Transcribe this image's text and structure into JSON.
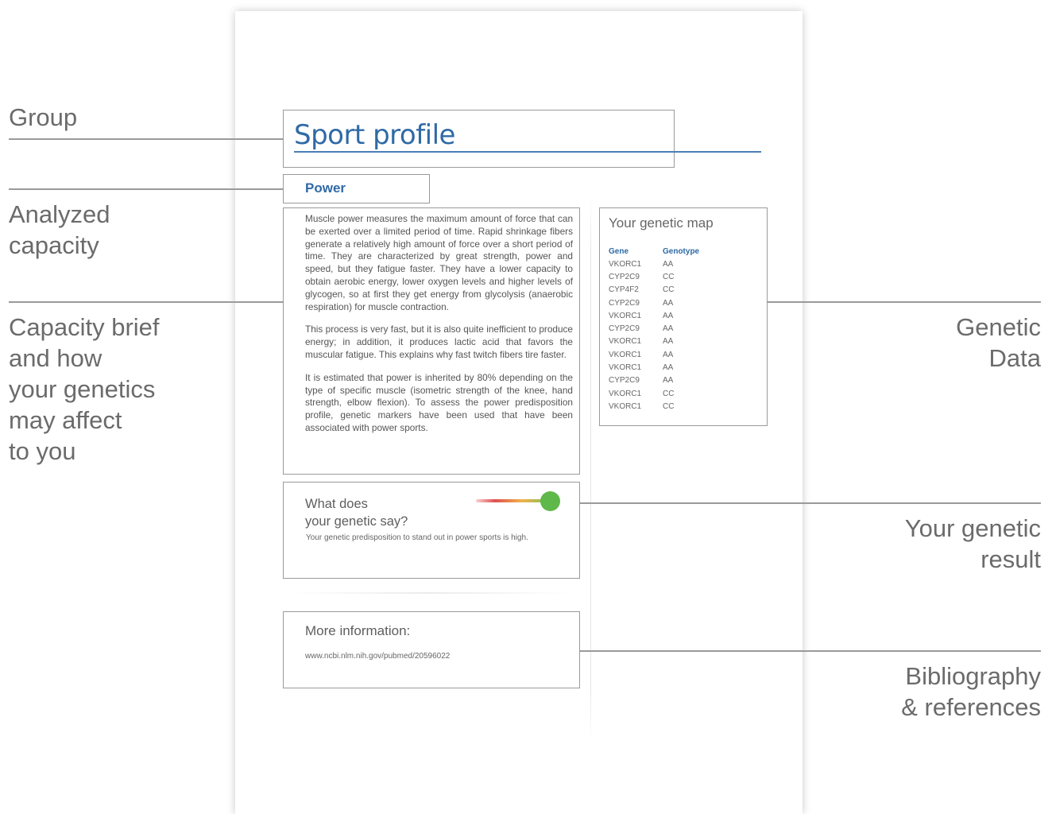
{
  "annotations": {
    "group": "Group",
    "analyzed_capacity": [
      "Analyzed",
      "capacity"
    ],
    "capacity_brief": [
      "Capacity brief",
      "and how",
      "your genetics",
      "may affect",
      "to you"
    ],
    "genetic_data": [
      "Genetic",
      "Data"
    ],
    "genetic_result": [
      "Your genetic",
      "result"
    ],
    "bibliography": [
      "Bibliography",
      "& references"
    ]
  },
  "document": {
    "group_title": "Sport profile",
    "capacity_title": "Power",
    "brief_paragraphs": [
      "Muscle power measures the maximum amount of force that can be exerted over a limited period of time. Rapid shrinkage fibers generate a relatively high amount of force over a short period of time. They are characterized by great strength, power and speed, but they fatigue faster. They have a lower capacity to obtain aerobic energy, lower oxygen levels and higher levels of glycogen, so at first they get energy from glycolysis (anaerobic respiration) for muscle contraction.",
      "This process is very fast, but it is also quite inefficient to produce energy; in addition, it produces lactic acid that favors the muscular fatigue. This explains why fast twitch fibers tire faster.",
      "It is estimated that power is inherited by 80% depending on the type of specific muscle (isometric strength of the knee, hand strength, elbow flexion). To assess the power predisposition profile, genetic markers have been used that have been associated with power sports."
    ],
    "genetic_map": {
      "title": "Your genetic map",
      "headers": [
        "Gene",
        "Genotype"
      ],
      "rows": [
        [
          "VKORC1",
          "AA"
        ],
        [
          "CYP2C9",
          "CC"
        ],
        [
          "CYP4F2",
          "CC"
        ],
        [
          "CYP2C9",
          "AA"
        ],
        [
          "VKORC1",
          "AA"
        ],
        [
          "CYP2C9",
          "AA"
        ],
        [
          "VKORC1",
          "AA"
        ],
        [
          "VKORC1",
          "AA"
        ],
        [
          "VKORC1",
          "AA"
        ],
        [
          "CYP2C9",
          "AA"
        ],
        [
          "VKORC1",
          "CC"
        ],
        [
          "VKORC1",
          "CC"
        ]
      ]
    },
    "result": {
      "title_line1": "What does",
      "title_line2": "your genetic say?",
      "text": "Your genetic predisposition to stand out in power sports is high.",
      "level": 1.0
    },
    "more_info": {
      "title": "More information:",
      "link": "www.ncbi.nlm.nih.gov/pubmed/20596022"
    }
  },
  "colors": {
    "accent_blue": "#2f6aa6",
    "knob_green": "#5fb84a",
    "line_gray": "#9a9a9a"
  }
}
